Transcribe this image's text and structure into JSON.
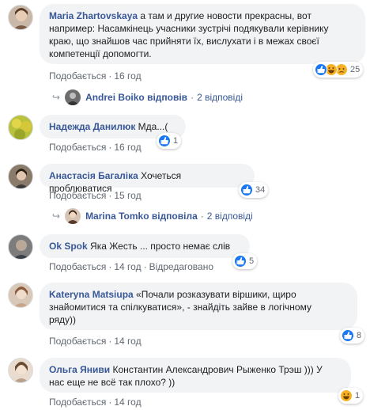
{
  "colors": {
    "link": "#385898",
    "meta": "#606770",
    "bubble": "#f2f3f5",
    "like": "#1877f2",
    "haha": "#f7b125"
  },
  "comments": [
    {
      "author": "Maria Zhartovskaya",
      "text_lines": [
        " а там и другие новости прекрасны, вот",
        "например: Насамкінець учасники зустрічі подякували керівнику",
        "краю, що знайшов час прийняти їх, вислухати і в межах своєї",
        "компетенції допомогти."
      ],
      "like": "Подобається",
      "time": "16 год",
      "reactions": {
        "icons": [
          "like-icon",
          "haha-icon",
          "sad-icon"
        ],
        "count": "25"
      },
      "replies": {
        "name": "Andrei Boiko відповів",
        "count": "2 відповіді"
      }
    },
    {
      "author": "Надежда Данилюк",
      "text_lines": [
        " Мда...("
      ],
      "like": "Подобається",
      "time": "16 год",
      "reactions": {
        "icons": [
          "like-icon"
        ],
        "count": "1"
      }
    },
    {
      "author": "Анастасія Багаліка",
      "text_lines": [
        " Хочеться проблюватися"
      ],
      "like": "Подобається",
      "time": "15 год",
      "reactions": {
        "icons": [
          "like-icon"
        ],
        "count": "34"
      },
      "replies": {
        "name": "Marina Tomko відповіла",
        "count": "2 відповіді"
      }
    },
    {
      "author": "Ok Spok",
      "text_lines": [
        " Яка Жесть ... просто немає слів"
      ],
      "like": "Подобається",
      "time": "14 год",
      "edited": "Відредаговано",
      "reactions": {
        "icons": [
          "like-icon"
        ],
        "count": "5"
      }
    },
    {
      "author": "Kateryna Matsiupa",
      "text_lines": [
        " «Почали розказувати віршики, щиро",
        "знайомитися та спілкуватися», - знайдіть зайве в логічному",
        "ряду))"
      ],
      "like": "Подобається",
      "time": "14 год",
      "reactions": {
        "icons": [
          "like-icon"
        ],
        "count": "8"
      }
    },
    {
      "author": "Ольга Яниви",
      "text_lines": [
        " Константин Александрович Рыженко Трэш ))) У",
        "нас еще не всё так плохо? ))"
      ],
      "like": "Подобається",
      "time": "14 год",
      "reactions": {
        "icons": [
          "haha-icon"
        ],
        "count": "1"
      }
    }
  ]
}
